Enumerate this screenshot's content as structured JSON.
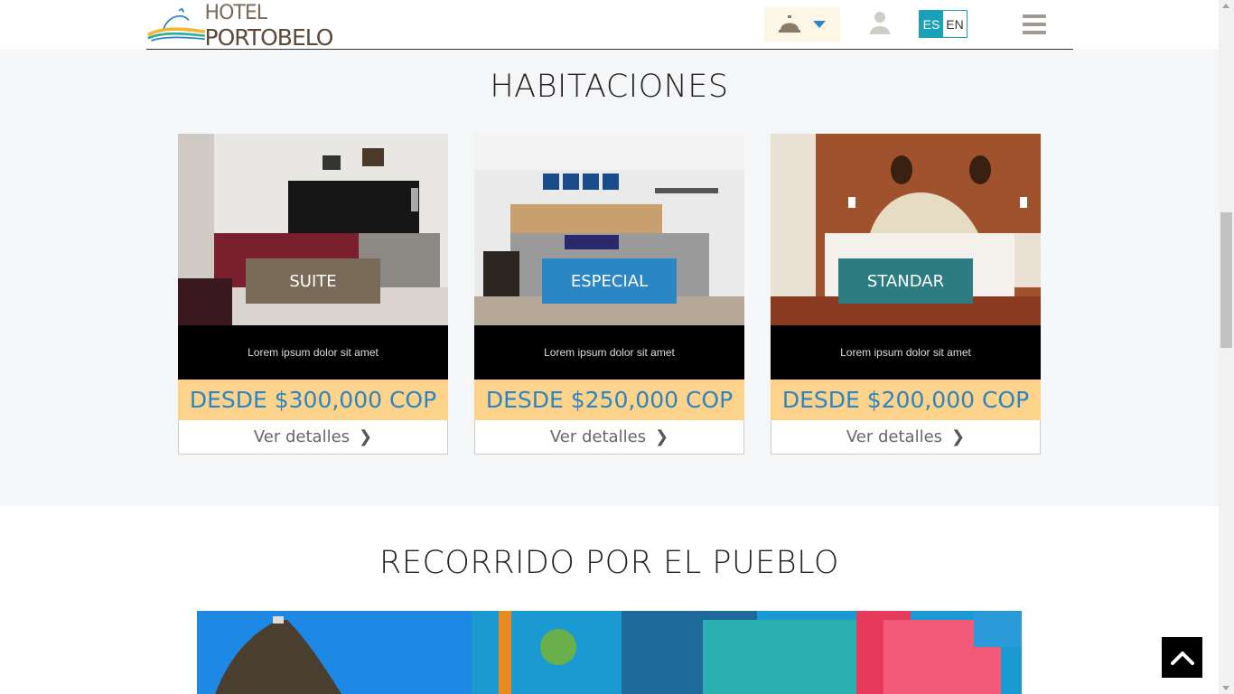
{
  "header": {
    "logo_word1": "HOTEL",
    "logo_word2": "PORTOBELO",
    "lang_es": "ES",
    "lang_en": "EN",
    "icons": [
      "bell-icon",
      "caret-down-icon",
      "user-icon",
      "menu-icon"
    ]
  },
  "rooms": {
    "title": "HABITACIONES",
    "cards": [
      {
        "label": "SUITE",
        "desc": "Lorem ipsum dolor sit amet",
        "price": "DESDE $300,000 COP",
        "details": "Ver detalles",
        "label_color": "#7a6a58"
      },
      {
        "label": "ESPECIAL",
        "desc": "Lorem ipsum dolor sit amet",
        "price": "DESDE $250,000 COP",
        "details": "Ver detalles",
        "label_color": "#2a86c4"
      },
      {
        "label": "STANDAR",
        "desc": "Lorem ipsum dolor sit amet",
        "price": "DESDE $200,000 COP",
        "details": "Ver detalles",
        "label_color": "#2d7c82"
      }
    ]
  },
  "tour": {
    "title": "RECORRIDO POR EL PUEBLO"
  },
  "colors": {
    "accent_teal": "#1aa0b8",
    "price_bg": "#fdd28a",
    "price_text": "#2a86c4"
  }
}
